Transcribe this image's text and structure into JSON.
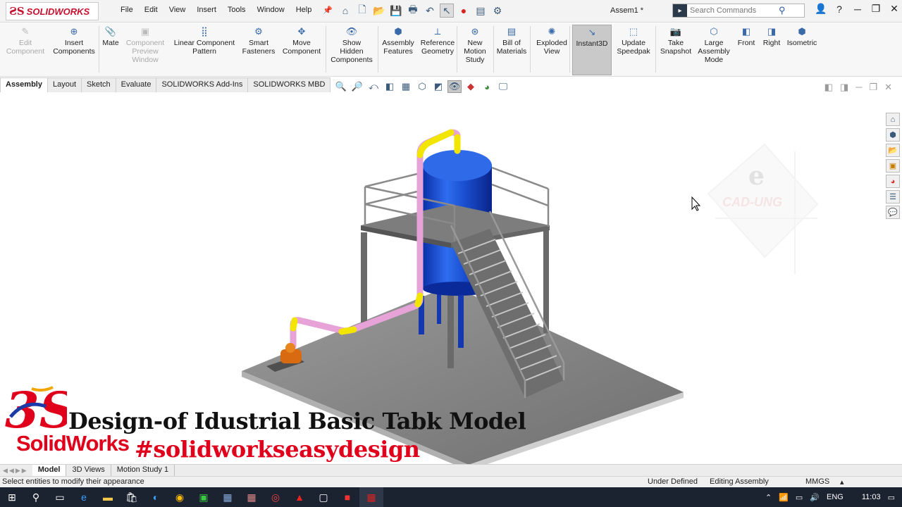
{
  "app": {
    "logo_text": "SOLIDWORKS",
    "document_title": "Assem1 *"
  },
  "menu": [
    "File",
    "Edit",
    "View",
    "Insert",
    "Tools",
    "Window",
    "Help"
  ],
  "search": {
    "placeholder": "Search Commands"
  },
  "ribbon": [
    {
      "label_lines": [
        "Edit",
        "Component"
      ],
      "icon": "edit-component-icon",
      "disabled": true
    },
    {
      "label_lines": [
        "Insert",
        "Components"
      ],
      "icon": "insert-components-icon",
      "disabled": false
    },
    {
      "label_lines": [
        "Mate"
      ],
      "icon": "mate-icon",
      "disabled": false
    },
    {
      "label_lines": [
        "Component",
        "Preview",
        "Window"
      ],
      "icon": "component-preview-icon",
      "disabled": true
    },
    {
      "label_lines": [
        "Linear Component",
        "Pattern"
      ],
      "icon": "linear-pattern-icon",
      "disabled": false
    },
    {
      "label_lines": [
        "Smart",
        "Fasteners"
      ],
      "icon": "smart-fasteners-icon",
      "disabled": false
    },
    {
      "label_lines": [
        "Move",
        "Component"
      ],
      "icon": "move-component-icon",
      "disabled": false
    },
    {
      "label_lines": [
        "Show",
        "Hidden",
        "Components"
      ],
      "icon": "show-hidden-icon",
      "disabled": false
    },
    {
      "label_lines": [
        "Assembly",
        "Features"
      ],
      "icon": "assembly-features-icon",
      "disabled": false
    },
    {
      "label_lines": [
        "Reference",
        "Geometry"
      ],
      "icon": "reference-geometry-icon",
      "disabled": false
    },
    {
      "label_lines": [
        "New",
        "Motion",
        "Study"
      ],
      "icon": "motion-study-icon",
      "disabled": false
    },
    {
      "label_lines": [
        "Bill of",
        "Materials"
      ],
      "icon": "bom-icon",
      "disabled": false
    },
    {
      "label_lines": [
        "Exploded",
        "View"
      ],
      "icon": "exploded-view-icon",
      "disabled": false
    },
    {
      "label_lines": [
        "Instant3D"
      ],
      "icon": "instant3d-icon",
      "disabled": false,
      "active": true
    },
    {
      "label_lines": [
        "Update",
        "Speedpak"
      ],
      "icon": "speedpak-icon",
      "disabled": false
    },
    {
      "label_lines": [
        "Take",
        "Snapshot"
      ],
      "icon": "snapshot-icon",
      "disabled": false
    },
    {
      "label_lines": [
        "Large",
        "Assembly",
        "Mode"
      ],
      "icon": "large-assembly-icon",
      "disabled": false
    },
    {
      "label_lines": [
        "Front"
      ],
      "icon": "front-view-icon",
      "disabled": false
    },
    {
      "label_lines": [
        "Right"
      ],
      "icon": "right-view-icon",
      "disabled": false
    },
    {
      "label_lines": [
        "Isometric"
      ],
      "icon": "isometric-view-icon",
      "disabled": false
    }
  ],
  "tabs": [
    "Assembly",
    "Layout",
    "Sketch",
    "Evaluate",
    "SOLIDWORKS Add-Ins",
    "SOLIDWORKS MBD"
  ],
  "watermark": {
    "letter": "e",
    "text": "CAD-UNG"
  },
  "overlay": {
    "logo_ds": "3S",
    "logo_text": "SolidWorks",
    "title": "Design-of Idustrial Basic Tabk Model",
    "hashtag": "#solidworkseasydesign"
  },
  "bottom_tabs": [
    "Model",
    "3D Views",
    "Motion Study 1"
  ],
  "status": {
    "message": "Select entities to modify their appearance",
    "definition": "Under Defined",
    "mode": "Editing Assembly",
    "units": "MMGS"
  },
  "taskbar": {
    "language": "ENG",
    "time": "11:03"
  }
}
